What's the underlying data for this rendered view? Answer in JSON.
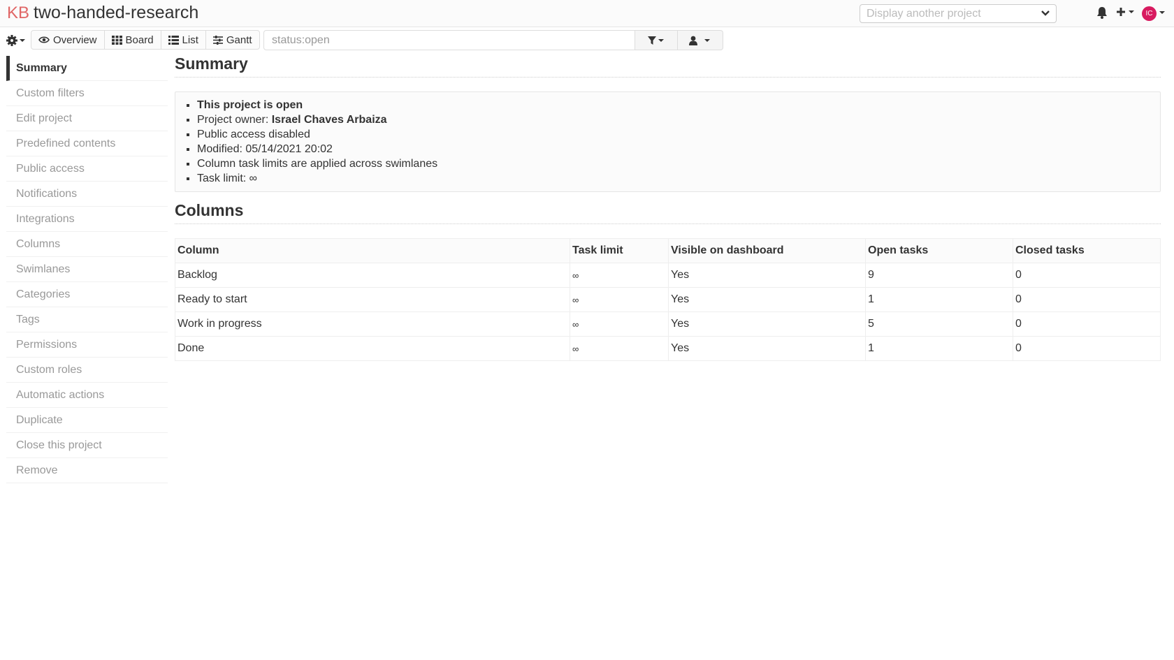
{
  "header": {
    "logo": "KB",
    "project_title": "two-handed-research",
    "project_select_placeholder": "Display another project",
    "avatar_initials": "IC"
  },
  "toolbar": {
    "views": [
      {
        "label": "Overview",
        "icon": "eye-icon"
      },
      {
        "label": "Board",
        "icon": "grid-icon"
      },
      {
        "label": "List",
        "icon": "list-icon"
      },
      {
        "label": "Gantt",
        "icon": "sliders-icon"
      }
    ],
    "filter_value": "status:open"
  },
  "sidebar": {
    "items": [
      {
        "label": "Summary",
        "active": true
      },
      {
        "label": "Custom filters"
      },
      {
        "label": "Edit project"
      },
      {
        "label": "Predefined contents"
      },
      {
        "label": "Public access"
      },
      {
        "label": "Notifications"
      },
      {
        "label": "Integrations"
      },
      {
        "label": "Columns"
      },
      {
        "label": "Swimlanes"
      },
      {
        "label": "Categories"
      },
      {
        "label": "Tags"
      },
      {
        "label": "Permissions"
      },
      {
        "label": "Custom roles"
      },
      {
        "label": "Automatic actions"
      },
      {
        "label": "Duplicate"
      },
      {
        "label": "Close this project"
      },
      {
        "label": "Remove"
      }
    ]
  },
  "summary": {
    "title": "Summary",
    "status": "This project is open",
    "owner_label": "Project owner: ",
    "owner_name": "Israel Chaves Arbaiza",
    "public_access": "Public access disabled",
    "modified": "Modified: 05/14/2021 20:02",
    "column_limits": "Column task limits are applied across swimlanes",
    "task_limit": "Task limit: ∞"
  },
  "columns": {
    "title": "Columns",
    "headers": [
      "Column",
      "Task limit",
      "Visible on dashboard",
      "Open tasks",
      "Closed tasks"
    ],
    "rows": [
      [
        "Backlog",
        "∞",
        "Yes",
        "9",
        "0"
      ],
      [
        "Ready to start",
        "∞",
        "Yes",
        "1",
        "0"
      ],
      [
        "Work in progress",
        "∞",
        "Yes",
        "5",
        "0"
      ],
      [
        "Done",
        "∞",
        "Yes",
        "1",
        "0"
      ]
    ]
  },
  "colors": {
    "logo_accent": "#e06666",
    "avatar_bg": "#d81b60",
    "muted_text": "#999999"
  }
}
